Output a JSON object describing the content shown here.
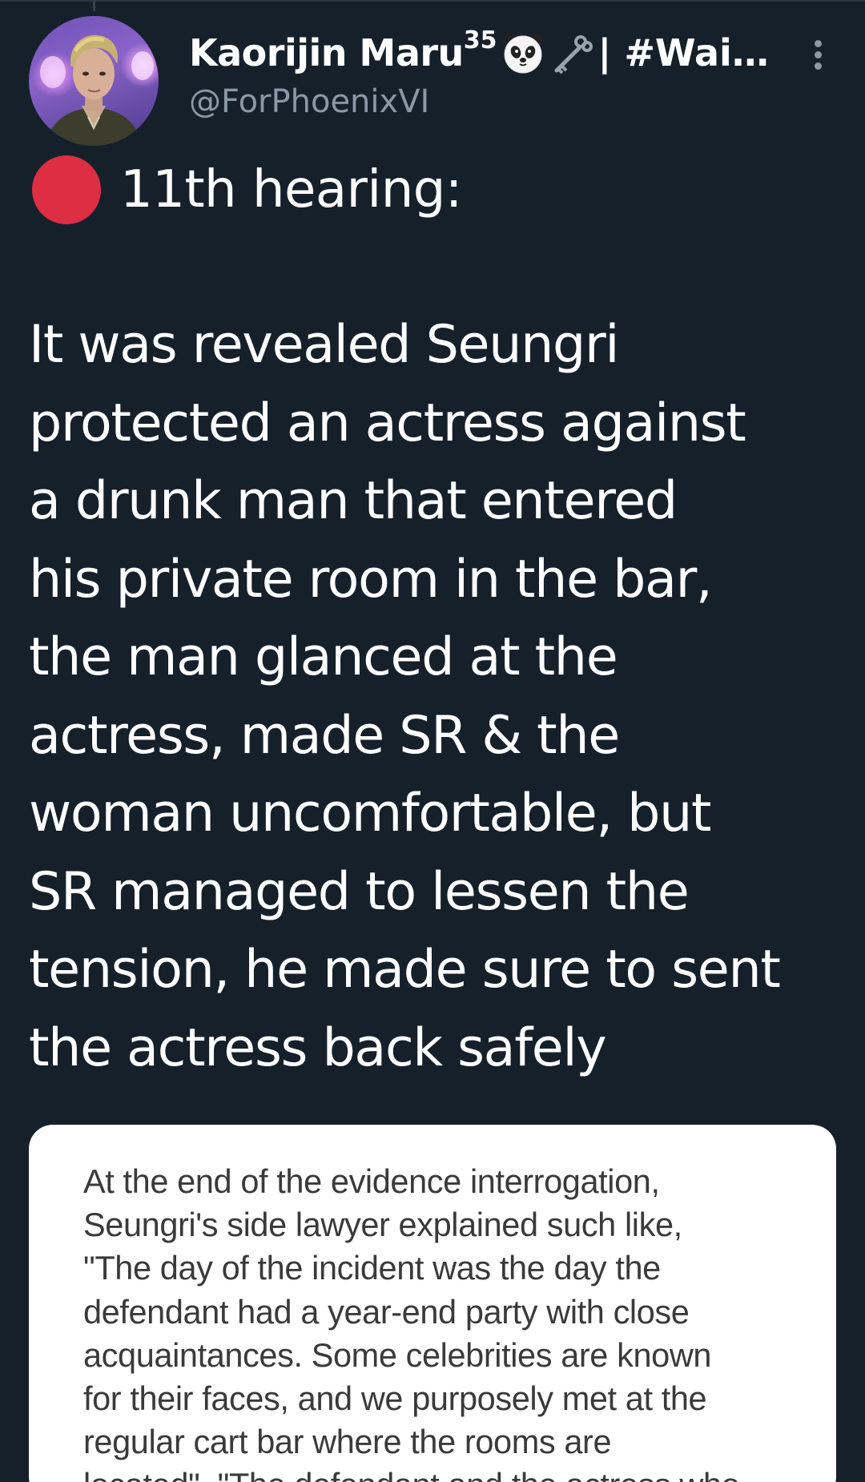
{
  "author": {
    "display_name": "Kaorijin Maru",
    "name_superscript": "35",
    "name_suffix": "| #Wai…",
    "handle": "@ForPhoenixVI",
    "emojis": [
      "panda-face-icon",
      "old-key-icon"
    ]
  },
  "tweet": {
    "heading": "11th hearing:",
    "bullet_color": "#dd2e44",
    "body_lines": [
      "It was revealed Seungri",
      "protected an actress against",
      "a drunk man that entered",
      "his private room in the bar,",
      "the man glanced at the",
      "actress, made SR & the",
      "woman uncomfortable, but",
      "SR managed to lessen the",
      "tension, he made sure to sent",
      "the actress back safely"
    ]
  },
  "media": {
    "text_lines": [
      "At the end of the evidence interrogation,",
      "Seungri's side lawyer explained such like,",
      "\"The day of the incident was the day the",
      "defendant had a year-end party with close",
      "acquaintances. Some celebrities are known",
      "for their faces, and we purposely met at the",
      "regular cart bar where the rooms are",
      "located\". \"The defendant and the actress who"
    ]
  },
  "colors": {
    "background": "#15202b",
    "text_primary": "#ffffff",
    "text_secondary": "#8b98a5"
  }
}
